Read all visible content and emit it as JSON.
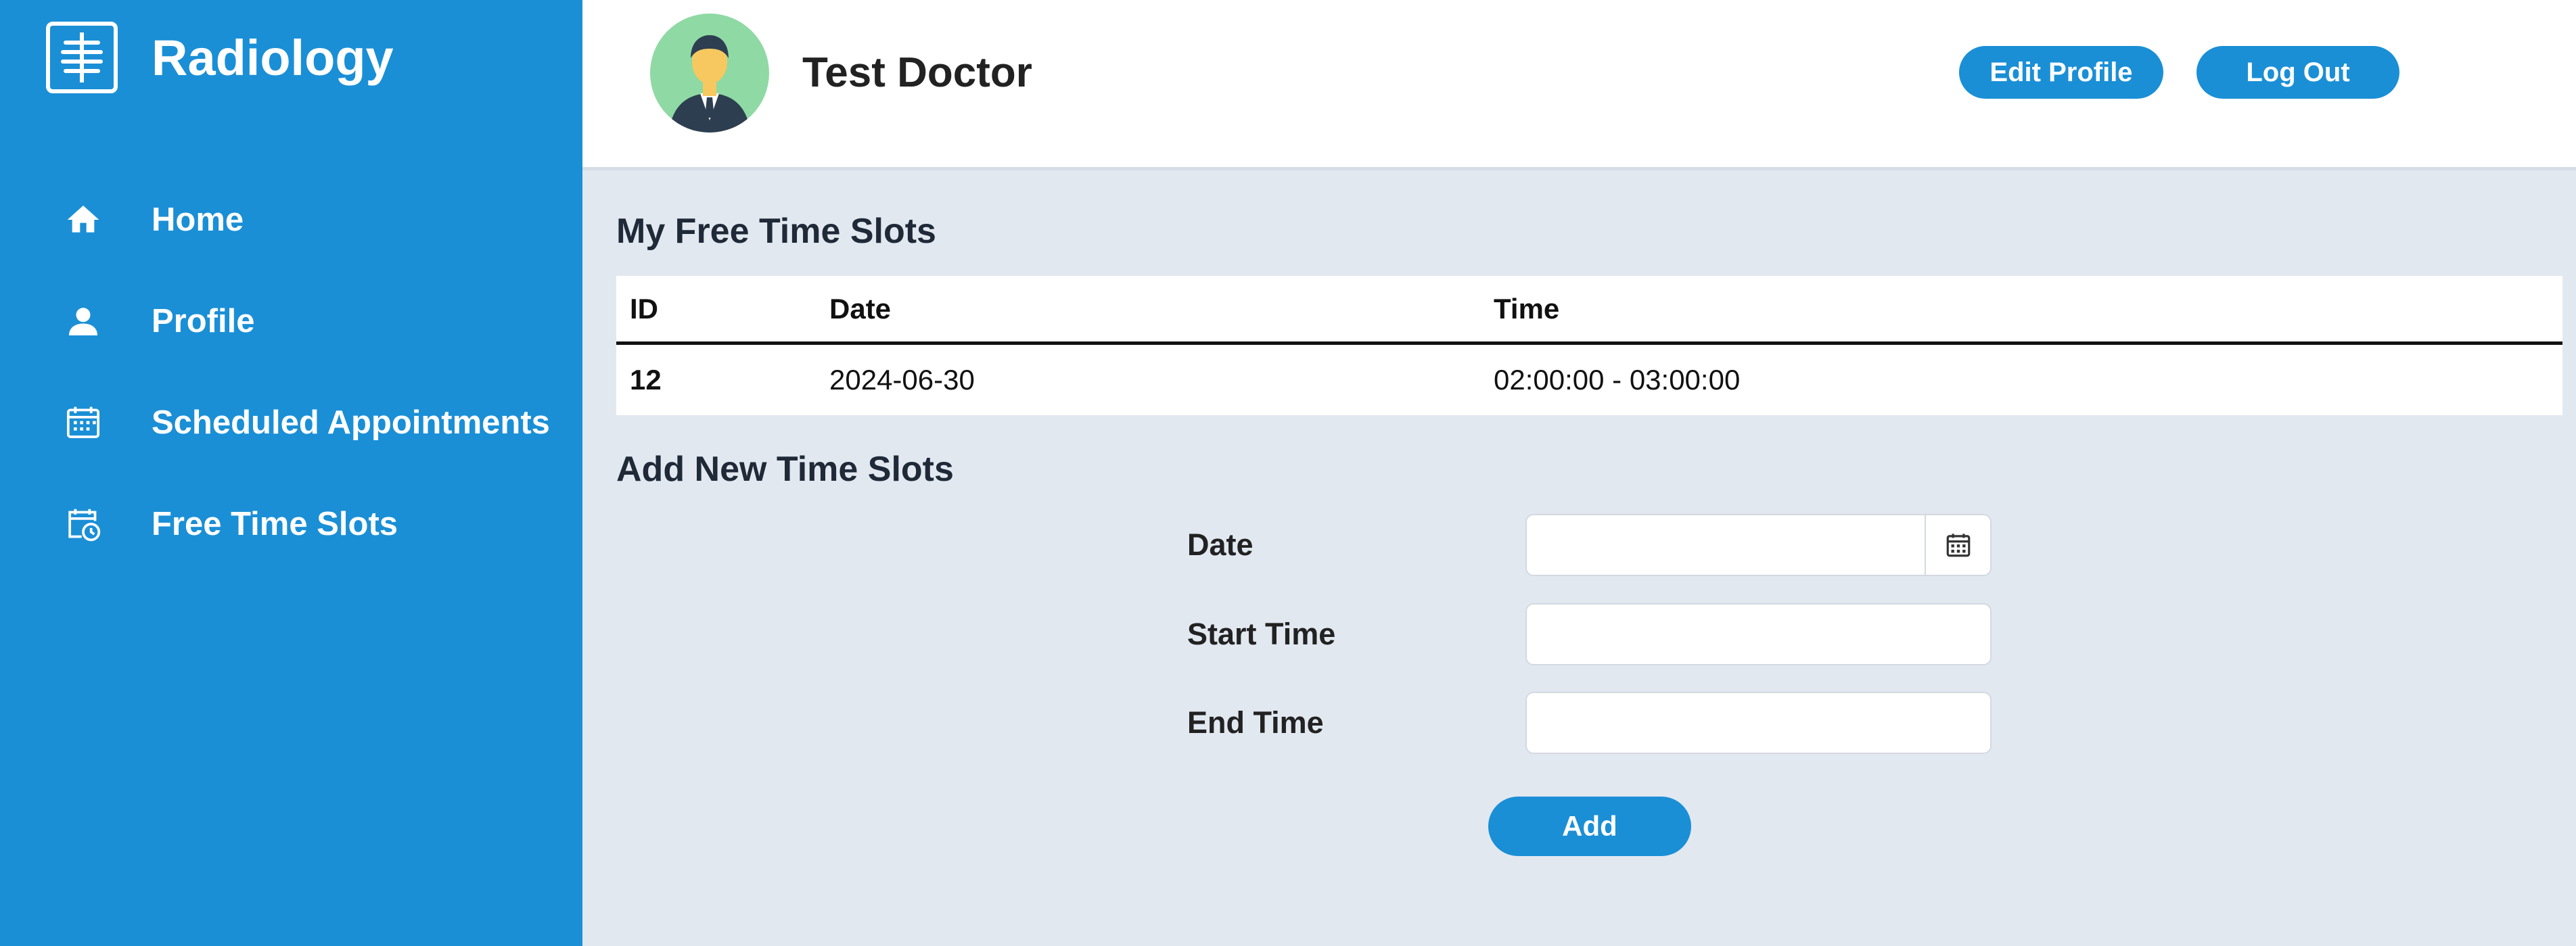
{
  "brand": {
    "name": "Radiology",
    "logo_icon": "xray-icon"
  },
  "sidebar": {
    "items": [
      {
        "label": "Home",
        "icon": "home-icon"
      },
      {
        "label": "Profile",
        "icon": "user-icon"
      },
      {
        "label": "Scheduled Appointments",
        "icon": "calendar-icon"
      },
      {
        "label": "Free Time Slots",
        "icon": "calendar-clock-icon"
      }
    ]
  },
  "header": {
    "doctor_name": "Test Doctor",
    "edit_profile_label": "Edit Profile",
    "logout_label": "Log Out"
  },
  "slots": {
    "title": "My Free Time Slots",
    "columns": [
      "ID",
      "Date",
      "Time"
    ],
    "rows": [
      {
        "id": "12",
        "date": "2024-06-30",
        "time": "02:00:00 - 03:00:00"
      }
    ]
  },
  "add_form": {
    "title": "Add New Time Slots",
    "date_label": "Date",
    "start_label": "Start Time",
    "end_label": "End Time",
    "date_value": "",
    "start_value": "",
    "end_value": "",
    "add_label": "Add"
  },
  "colors": {
    "accent": "#1a8fd6",
    "background": "#e2e8f0",
    "avatar_bg": "#8fd9a4"
  }
}
